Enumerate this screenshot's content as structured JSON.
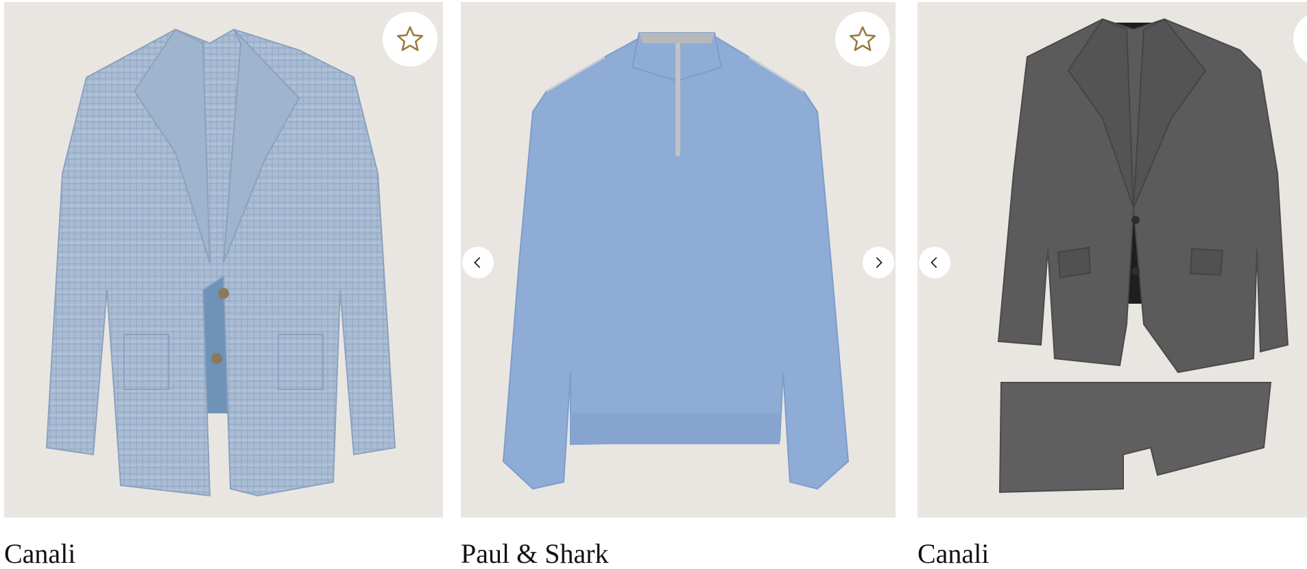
{
  "products": [
    {
      "brand": "Canali",
      "image_alt": "light blue plaid blazer",
      "favorite_icon": "star-outline-icon",
      "has_prev_arrow": false,
      "has_next_arrow": false
    },
    {
      "brand": "Paul & Shark",
      "image_alt": "light blue quarter-zip sweater",
      "favorite_icon": "star-outline-icon",
      "has_prev_arrow": true,
      "has_next_arrow": true
    },
    {
      "brand": "Canali",
      "image_alt": "charcoal grey two-piece suit",
      "favorite_icon": "star-outline-icon",
      "has_prev_arrow": true,
      "has_next_arrow": false
    }
  ],
  "colors": {
    "image_background": "#e9e6e1",
    "star_gold": "#9a7a3c",
    "text": "#111111",
    "arrow_bg": "#ffffff"
  }
}
